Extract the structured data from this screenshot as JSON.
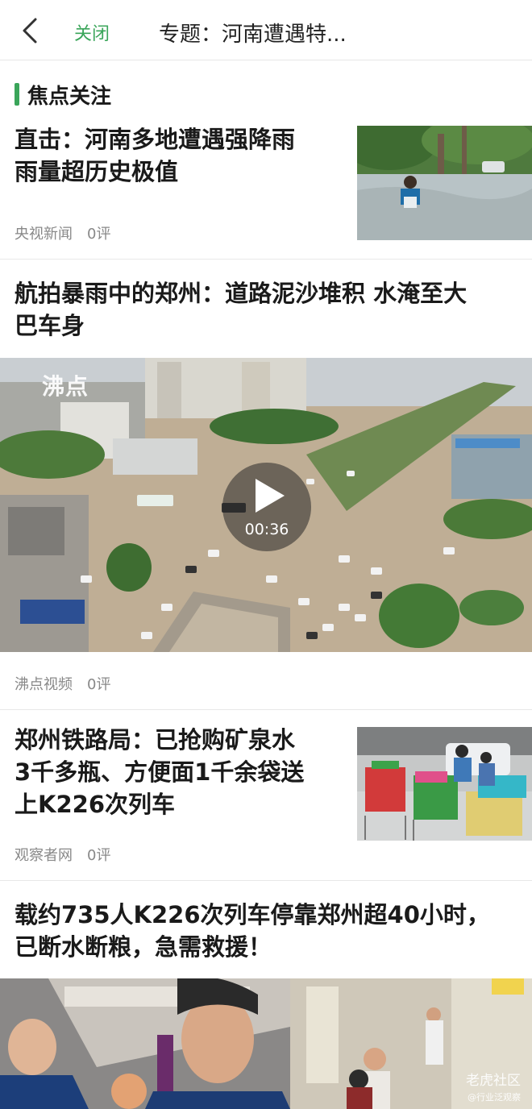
{
  "header": {
    "back_icon": "chevron-left-icon",
    "close_label": "关闭",
    "title": "专题：河南遭遇特..."
  },
  "section": {
    "label": "焦点关注",
    "accent": "#3aa55a"
  },
  "articles": [
    {
      "title_lines": [
        "直击：河南多地遭遇强降雨",
        "雨量超历史极值"
      ],
      "source": "央视新闻",
      "comments": "0评"
    },
    {
      "title_lines": [
        "航拍暴雨中的郑州：道路泥沙堆积 水淹至大",
        "巴车身"
      ],
      "source": "沸点视频",
      "comments": "0评",
      "video_duration": "00:36",
      "watermark": "沸点"
    },
    {
      "title_lines": [
        "郑州铁路局：已抢购矿泉水",
        "3千多瓶、方便面1千余袋送",
        "上K226次列车"
      ],
      "source": "观察者网",
      "comments": "0评"
    },
    {
      "title_lines": [
        "载约735人K226次列车停靠郑州超40小时，",
        "已断水断粮，急需救援！"
      ]
    }
  ],
  "watermark": {
    "brand": "老虎社区",
    "handle": "@行业泛观察"
  }
}
